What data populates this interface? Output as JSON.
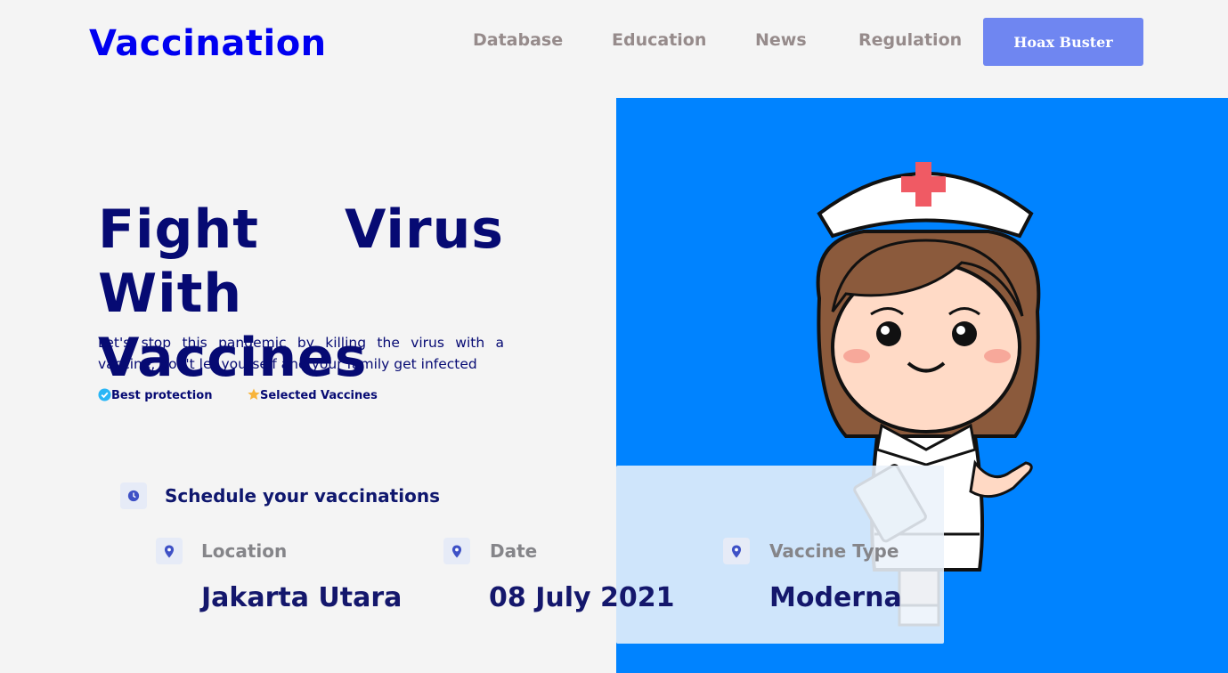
{
  "header": {
    "logo": "Vaccination",
    "nav": [
      "Database",
      "Education",
      "News",
      "Regulation"
    ],
    "cta_label": "Hoax Buster"
  },
  "hero": {
    "title_line1_a": "Fight",
    "title_line1_b": "Virus",
    "title_line2": "With Vaccines",
    "subtitle": "Let's stop this pandemic by killing the virus with a vaccine, don't let yourself and your family get infected",
    "features": [
      {
        "label": "Best protection",
        "icon": "check-badge-icon"
      },
      {
        "label": "Selected Vaccines",
        "icon": "star-icon"
      }
    ]
  },
  "schedule": {
    "title": "Schedule your vaccinations",
    "icon": "clock-icon",
    "fields": [
      {
        "label": "Location",
        "value": "Jakarta Utara",
        "icon": "location-pin-icon"
      },
      {
        "label": "Date",
        "value": "08 July 2021",
        "icon": "location-pin-icon"
      },
      {
        "label": "Vaccine Type",
        "value": "Moderna",
        "icon": "location-pin-icon"
      }
    ]
  },
  "colors": {
    "brand": "#0000f0",
    "hero_panel": "#0083ff",
    "cta": "#6f86f1",
    "title_text": "#060a73"
  }
}
